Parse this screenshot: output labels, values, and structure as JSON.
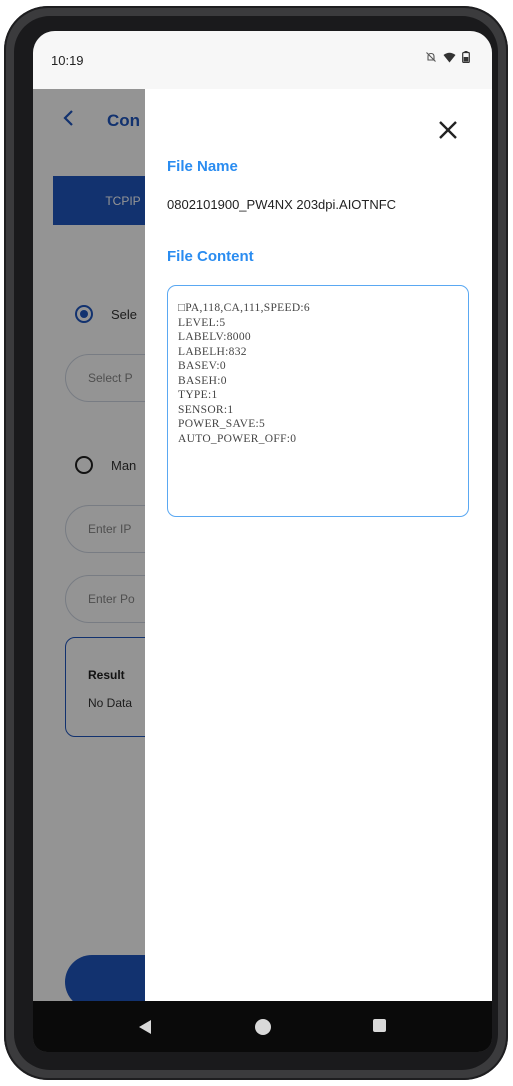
{
  "status_bar": {
    "time": "10:19",
    "icons": [
      "notifications-off-icon",
      "wifi-icon",
      "battery-icon"
    ]
  },
  "app": {
    "title": "Con",
    "tab_label": "TCPIP",
    "option_select_label": "Sele",
    "select_placeholder": "Select P",
    "option_manual_label": "Man",
    "ip_placeholder": "Enter IP",
    "port_placeholder": "Enter Po",
    "result_title": "Result",
    "result_value": "No Data"
  },
  "drawer": {
    "file_name_label": "File Name",
    "file_name": "0802101900_PW4NX 203dpi.AIOTNFC",
    "file_content_label": "File Content",
    "file_content": "□PA,118,CA,111,SPEED:6\nLEVEL:5\nLABELV:8000\nLABELH:832\nBASEV:0\nBASEH:0\nTYPE:1\nSENSOR:1\nPOWER_SAVE:5\nAUTO_POWER_OFF:0"
  },
  "colors": {
    "accent": "#2a8cf0",
    "primary": "#1f56c0"
  }
}
